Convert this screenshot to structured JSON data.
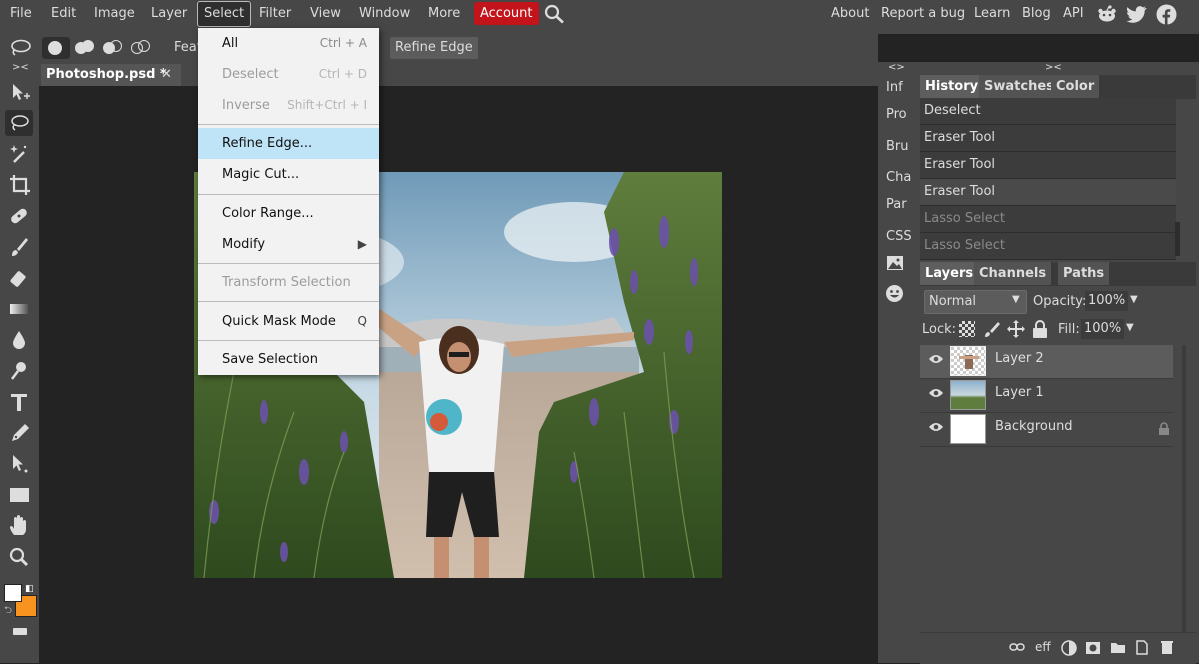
{
  "menubar": {
    "items": [
      "File",
      "Edit",
      "Image",
      "Layer",
      "Select",
      "Filter",
      "View",
      "Window",
      "More"
    ],
    "account": "Account",
    "right_links": [
      "About",
      "Report a bug",
      "Learn",
      "Blog",
      "API"
    ]
  },
  "options": {
    "feather_label": "Feat",
    "refine_edge": "Refine Edge"
  },
  "document": {
    "tab_title": "Photoshop.psd *",
    "close_glyph": "✕"
  },
  "panel_toggles": {
    "left": "><",
    "mini": "<>",
    "right": "><"
  },
  "mini_panel": [
    "Inf",
    "Pro",
    "Bru",
    "Cha",
    "Par",
    "CSS"
  ],
  "select_menu": [
    {
      "label": "All",
      "shortcut": "Ctrl + A",
      "disabled": false
    },
    {
      "label": "Deselect",
      "shortcut": "Ctrl + D",
      "disabled": true
    },
    {
      "label": "Inverse",
      "shortcut": "Shift+Ctrl + I",
      "disabled": true
    },
    {
      "label": "Refine Edge...",
      "shortcut": "",
      "highlighted": true
    },
    {
      "label": "Magic Cut...",
      "shortcut": ""
    },
    {
      "label": "Color Range...",
      "shortcut": ""
    },
    {
      "label": "Modify",
      "shortcut": "▶"
    },
    {
      "label": "Transform Selection",
      "shortcut": "",
      "disabled": true
    },
    {
      "label": "Quick Mask Mode",
      "shortcut": "Q"
    },
    {
      "label": "Save Selection",
      "shortcut": ""
    }
  ],
  "history": {
    "tabs": [
      "History",
      "Swatches",
      "Color"
    ],
    "items": [
      "Deselect",
      "Eraser Tool",
      "Eraser Tool",
      "Eraser Tool",
      "Lasso Select",
      "Lasso Select"
    ]
  },
  "layers": {
    "tabs": [
      "Layers",
      "Channels",
      "Paths"
    ],
    "blend_mode": "Normal",
    "opacity_label": "Opacity:",
    "opacity": "100%",
    "lock_label": "Lock:",
    "fill_label": "Fill:",
    "fill": "100%",
    "items": [
      {
        "name": "Layer 2",
        "selected": true
      },
      {
        "name": "Layer 1",
        "selected": false
      },
      {
        "name": "Background",
        "selected": false,
        "locked": true
      }
    ],
    "footer_eff": "eff"
  },
  "colors": {
    "accent_account": "#c4141b",
    "foreground": "#ffffff",
    "background": "#f7931e",
    "menu_highlight": "#bfe4f8"
  }
}
